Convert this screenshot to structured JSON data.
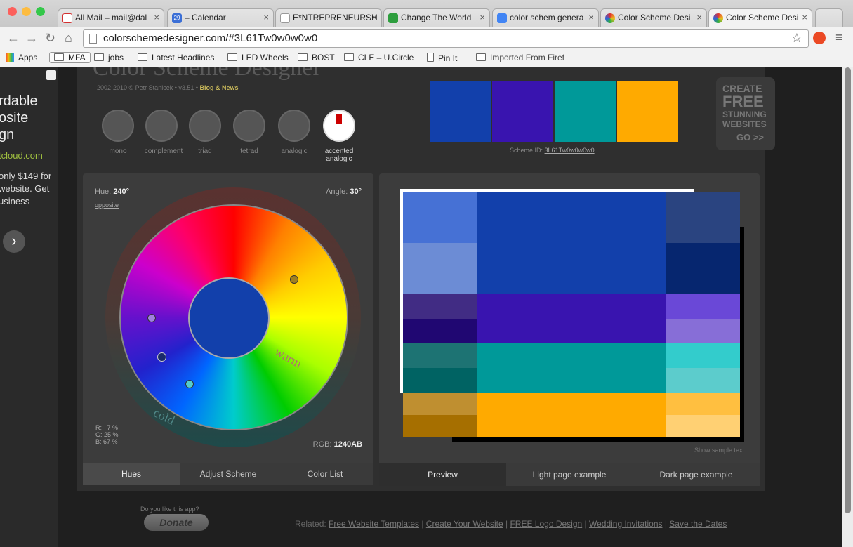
{
  "browser": {
    "tabs": [
      {
        "title": "All Mail – mail@dal",
        "fav": "#d32f2f"
      },
      {
        "title": "– Calendar",
        "fav": "#3b6fd6"
      },
      {
        "title": "E*NTREPRENEURSH",
        "fav": "#ffffff"
      },
      {
        "title": "Change The World",
        "fav": "#2e9e3e"
      },
      {
        "title": "color schem genera",
        "fav": "#4285f4"
      },
      {
        "title": "Color Scheme Desi",
        "fav": "#e03030"
      },
      {
        "title": "Color Scheme Desi",
        "fav": "#e03030"
      }
    ],
    "calendar_badge": "29",
    "url": "colorschemedesigner.com/#3L61Tw0w0w0w0",
    "bookmarks": [
      "Apps",
      "MFA",
      "jobs",
      "Latest Headlines",
      "LED Wheels",
      "BOST",
      "CLE – U.Circle",
      "Pin It",
      "Imported From Firef"
    ]
  },
  "ad": {
    "lines": [
      "rdable",
      "osite",
      "gn"
    ],
    "url": "tcloud.com",
    "body": [
      "only $149 for",
      "website. Get",
      "usiness"
    ]
  },
  "app": {
    "title": "Color Scheme Designer",
    "credits": "2002-2010 © Petr Stanicek • v3.51 •",
    "blog_link": "Blog & News",
    "scheme_types": [
      "mono",
      "complement",
      "triad",
      "tetrad",
      "analogic",
      "accented analogic"
    ],
    "scheme_id_label": "Scheme ID:",
    "scheme_id": "3L61Tw0w0w0w0",
    "swatches": [
      "#1240AB",
      "#3914AF",
      "#009999",
      "#FFAA00"
    ],
    "promo": [
      "CREATE",
      "FREE",
      "STUNNING",
      "WEBSITES",
      "GO >>"
    ]
  },
  "wheel": {
    "hue_label": "Hue:",
    "hue_value": "240°",
    "angle_label": "Angle:",
    "angle_value": "30°",
    "opposite": "opposite",
    "warm": "warm",
    "cold": "cold",
    "r": "R:   7 %",
    "g": "G: 25 %",
    "b": "B: 67 %",
    "rgb_label": "RGB:",
    "rgb_value": "1240AB",
    "center_color": "#1240AB"
  },
  "left_tabs": [
    "Hues",
    "Adjust Scheme",
    "Color List"
  ],
  "preview": {
    "show_sample": "Show sample text",
    "rows": [
      {
        "left": [
          "#4671D5",
          "#6C8CD5"
        ],
        "mid": "#1240AB",
        "right": [
          "#2A4480",
          "#06266F"
        ]
      },
      {
        "left": [
          "#412C84",
          "#200772"
        ],
        "mid": "#3914AF",
        "right": [
          "#6A48D7",
          "#876ED7"
        ]
      },
      {
        "left": [
          "#1D7373",
          "#006363"
        ],
        "mid": "#009999",
        "right": [
          "#33CCCC",
          "#5CCCCC"
        ]
      },
      {
        "left": [
          "#BF8F30",
          "#A66F00"
        ],
        "mid": "#FFAA00",
        "right": [
          "#FFBF40",
          "#FFD073"
        ]
      }
    ]
  },
  "right_tabs": [
    "Preview",
    "Light page example",
    "Dark page example"
  ],
  "footer": {
    "like": "Do you like this app?",
    "donate": "Donate",
    "related": "Related:",
    "links": [
      "Free Website Templates",
      "Create Your Website",
      "FREE Logo Design",
      "Wedding Invitations",
      "Save the Dates"
    ]
  }
}
